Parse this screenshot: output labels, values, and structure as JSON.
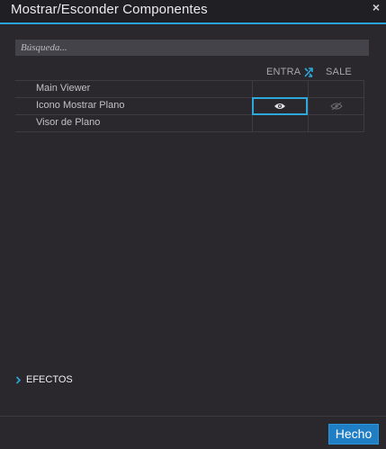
{
  "window": {
    "title": "Mostrar/Esconder Componentes",
    "close_label": "×"
  },
  "search": {
    "placeholder": "Búsqueda...",
    "value": ""
  },
  "columns": {
    "in_label": "ENTRA",
    "out_label": "SALE"
  },
  "rows": [
    {
      "label": "Main Viewer",
      "in_state": "",
      "out_state": ""
    },
    {
      "label": "Icono Mostrar Plano",
      "in_state": "visible-eye",
      "out_state": "hidden-eye"
    },
    {
      "label": "Visor de Plano",
      "in_state": "",
      "out_state": ""
    }
  ],
  "efectos": {
    "label": "EFECTOS",
    "expanded": false
  },
  "footer": {
    "done_label": "Hecho"
  },
  "colors": {
    "accent": "#28a4d8",
    "button": "#1f7ec4",
    "background": "#2a282d",
    "titlebar": "#201f23"
  },
  "icons": {
    "close": "close-icon",
    "swap": "swap-columns-icon",
    "visible": "eye-icon",
    "hidden": "eye-slash-icon",
    "expand": "chevron-right-icon"
  }
}
